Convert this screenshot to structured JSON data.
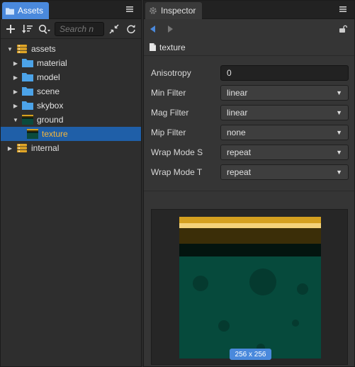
{
  "assets_panel": {
    "tab_label": "Assets",
    "search_placeholder": "Search n",
    "tree": [
      {
        "label": "assets",
        "expanded": true,
        "icon": "database-icon"
      },
      {
        "label": "material",
        "icon": "folder-icon"
      },
      {
        "label": "model",
        "icon": "folder-icon"
      },
      {
        "label": "scene",
        "icon": "folder-icon"
      },
      {
        "label": "skybox",
        "icon": "folder-icon"
      },
      {
        "label": "ground",
        "expanded": true,
        "icon": "texture-icon"
      },
      {
        "label": "texture",
        "selected": true,
        "icon": "texture-icon"
      },
      {
        "label": "internal",
        "icon": "database-icon"
      }
    ]
  },
  "inspector_panel": {
    "tab_label": "Inspector",
    "asset_name": "texture",
    "properties": [
      {
        "label": "Anisotropy",
        "value": "0",
        "kind": "number"
      },
      {
        "label": "Min Filter",
        "value": "linear",
        "kind": "select"
      },
      {
        "label": "Mag Filter",
        "value": "linear",
        "kind": "select"
      },
      {
        "label": "Mip Filter",
        "value": "none",
        "kind": "select"
      },
      {
        "label": "Wrap Mode S",
        "value": "repeat",
        "kind": "select"
      },
      {
        "label": "Wrap Mode T",
        "value": "repeat",
        "kind": "select"
      }
    ],
    "preview_size": "256 x 256"
  },
  "colors": {
    "accent": "#4a89dc",
    "selected_row": "#1f5fa8",
    "selected_text": "#f6b73c",
    "folder": "#4ca3e8"
  }
}
